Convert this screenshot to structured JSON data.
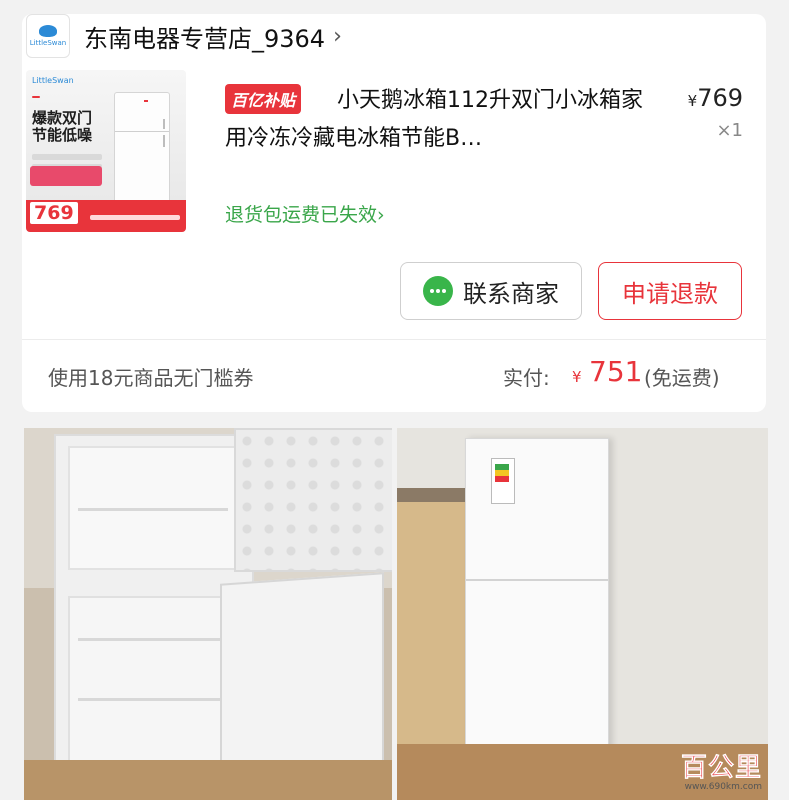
{
  "shop": {
    "name": "东南电器专营店_9364",
    "chevron": "›",
    "logo_text": "LittleSwan"
  },
  "product": {
    "thumbnail": {
      "brand": "LittleSwan",
      "headline": "爆款双门 节能低噪",
      "price": "769"
    },
    "subsidy_badge": "百亿补贴",
    "title": "小天鹅冰箱112升双门小冰箱家用冷冻冷藏电冰箱节能B…",
    "price_symbol": "¥",
    "price": "769",
    "quantity": "×1",
    "returns_note": "退货包运费已失效›"
  },
  "actions": {
    "contact_label": "联系商家",
    "refund_label": "申请退款"
  },
  "summary": {
    "coupon": "使用18元商品无门槛券",
    "paid_label": "实付:",
    "paid_symbol": "¥",
    "paid_amount": "751",
    "shipping": "(免运费)"
  },
  "watermark": {
    "text": "百公里",
    "url": "www.690km.com"
  },
  "colors": {
    "accent_red": "#e8343b",
    "green": "#3aa64a",
    "background": "#f2f2f2"
  },
  "icons": [
    "chevron-right-icon",
    "wechat-icon"
  ]
}
